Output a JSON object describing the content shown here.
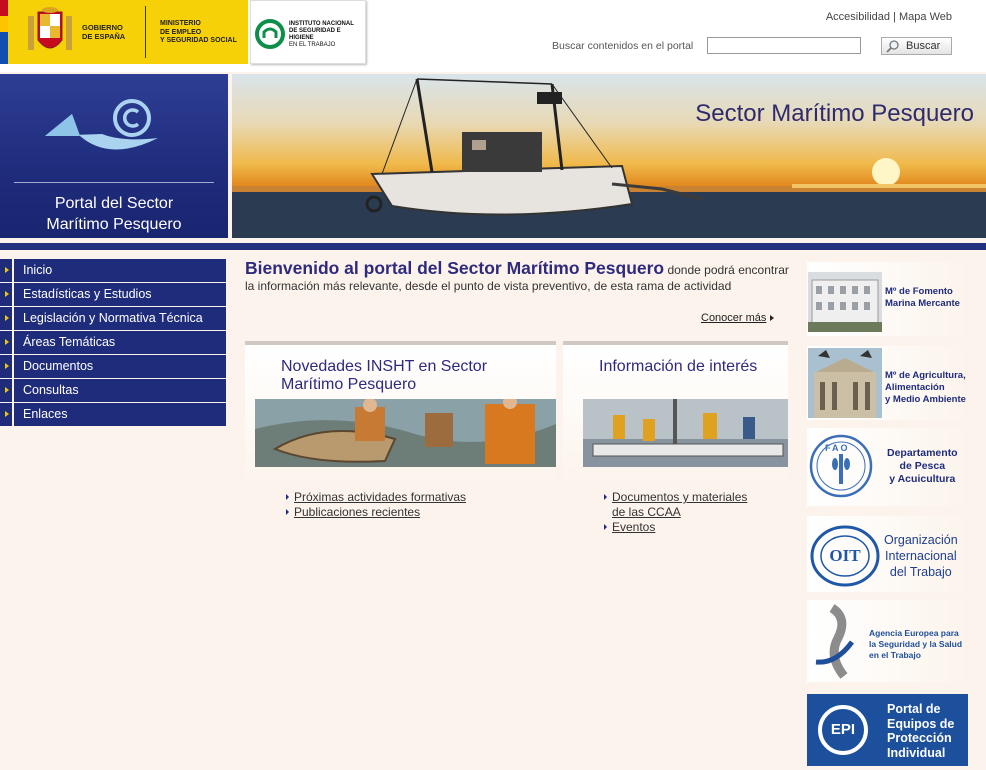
{
  "header": {
    "gov_line1": "GOBIERNO",
    "gov_line2": "DE ESPAÑA",
    "ministry_line1": "MINISTERIO",
    "ministry_line2": "DE EMPLEO",
    "ministry_line3": "Y SEGURIDAD SOCIAL",
    "insht_line1": "INSTITUTO NACIONAL",
    "insht_line2": "DE SEGURIDAD E HIGIENE",
    "insht_line3": "EN EL TRABAJO",
    "util_accesibilidad": "Accesibilidad",
    "util_separator": "|",
    "util_mapa": "Mapa Web",
    "search_label": "Buscar contenidos en el portal",
    "search_placeholder": "",
    "search_button": "Buscar"
  },
  "banner": {
    "portal_line1": "Portal del Sector",
    "portal_line2": "Marítimo Pesquero",
    "title": "Sector Marítimo Pesquero"
  },
  "sidebar": {
    "items": [
      {
        "label": "Inicio"
      },
      {
        "label": "Estadísticas y Estudios"
      },
      {
        "label": "Legislación y Normativa Técnica"
      },
      {
        "label": "Áreas Temáticas"
      },
      {
        "label": "Documentos"
      },
      {
        "label": "Consultas"
      },
      {
        "label": "Enlaces"
      }
    ]
  },
  "welcome": {
    "title": "Bienvenido al portal del Sector Marítimo Pesquero",
    "text": " donde podrá encontrar la información más relevante, desde el punto de vista preventivo, de esta rama de actividad",
    "more": "Conocer más"
  },
  "panels": {
    "novedades": {
      "title_line1": "Novedades INSHT en Sector",
      "title_line2": "Marítimo Pesquero",
      "links": [
        "Próximas actividades formativas",
        "Publicaciones recientes"
      ]
    },
    "info": {
      "title": "Información de interés",
      "link1_line1": "Documentos y materiales",
      "link1_line2": "de las CCAA",
      "link2": "Eventos"
    }
  },
  "rightcol": {
    "fomento_line1": "Mº de Fomento",
    "fomento_line2": "Marina  Mercante",
    "agricultura_line1": "Mº de Agricultura,",
    "agricultura_line2": "Alimentación",
    "agricultura_line3": "y Medio Ambiente",
    "fao_letters": "FAO",
    "fao_line1": "Departamento",
    "fao_line2": "de Pesca",
    "fao_line3": "y Acuicultura",
    "oit_letters": "OIT",
    "oit_line1": "Organización",
    "oit_line2": "Internacional",
    "oit_line3": "del Trabajo",
    "agencia_line1": "Agencia Europea para",
    "agencia_line2": "la Seguridad y la Salud",
    "agencia_line3": "en el Trabajo",
    "epi_letters": "EPI",
    "epi_line1": "Portal de",
    "epi_line2": "Equipos de",
    "epi_line3": "Protección",
    "epi_line4": "Individual"
  },
  "colors": {
    "navy": "#1f2c7c",
    "title_blue": "#2f2a7e",
    "gov_yellow": "#f7d108",
    "page_bg": "#fcf4ec"
  }
}
